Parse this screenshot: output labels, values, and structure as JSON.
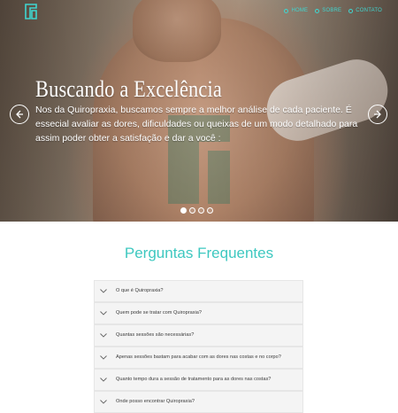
{
  "nav": {
    "items": [
      {
        "label": "HOME"
      },
      {
        "label": "SOBRE"
      },
      {
        "label": "CONTATO"
      }
    ],
    "color": "#3fd6d0"
  },
  "hero": {
    "title": "Buscando a Excelência",
    "text": "Nos da Quiropraxia, buscamos sempre a melhor análise de cada paciente. É essecial avaliar as dores, dificuldades ou queixas de um modo detalhado para assim poder obter a satisfação e dar a você :",
    "slides": 4,
    "active_slide": 1
  },
  "faq": {
    "title": "Perguntas Frequentes",
    "questions": [
      "O que é Quiropraxia?",
      "Quem pode se tratar com Quiropraxia?",
      "Quantas sessões são necessárias?",
      "Apenas sessões bastam para acabar com as dores nas costas e no corpo?",
      "Quanto tempo dura a sessão de tratamento para as dores nas costas?",
      "Onde posso encontrar Quiropraxia?"
    ],
    "accent": "#3ec8c0"
  }
}
